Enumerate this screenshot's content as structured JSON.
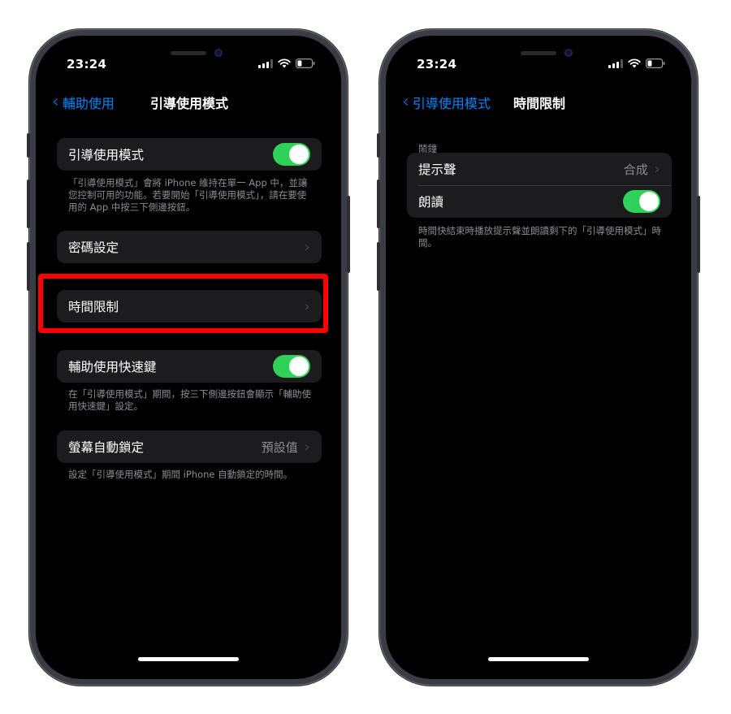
{
  "left": {
    "status": {
      "time": "23:24"
    },
    "nav": {
      "back_label": "輔助使用",
      "title": "引導使用模式"
    },
    "guided_access": {
      "label": "引導使用模式",
      "toggle_on": true
    },
    "guided_access_note": "「引導使用模式」會將 iPhone 維持在單一 App 中，並讓您控制可用的功能。若要開始「引導使用模式」，請在要使用的 App 中按三下側邊按鈕。",
    "passcode": {
      "label": "密碼設定"
    },
    "time_limits": {
      "label": "時間限制"
    },
    "accessibility_shortcut": {
      "label": "輔助使用快速鍵",
      "toggle_on": true
    },
    "accessibility_shortcut_note": "在「引導使用模式」期間，按三下側邊按鈕會顯示「輔助使用快速鍵」設定。",
    "auto_lock": {
      "label": "螢幕自動鎖定",
      "value": "預設值"
    },
    "auto_lock_note": "設定「引導使用模式」期間 iPhone 自動鎖定的時間。"
  },
  "right": {
    "status": {
      "time": "23:24"
    },
    "nav": {
      "back_label": "引導使用模式",
      "title": "時間限制"
    },
    "section_header": "鬧鐘",
    "sound": {
      "label": "提示聲",
      "value": "合成"
    },
    "speak": {
      "label": "朗讀",
      "toggle_on": true
    },
    "note": "時間快結束時播放提示聲並朗讀剩下的「引導使用模式」時間。"
  },
  "colors": {
    "accent": "#0a84ff",
    "toggle_on": "#30d158",
    "highlight": "#ff0000"
  }
}
